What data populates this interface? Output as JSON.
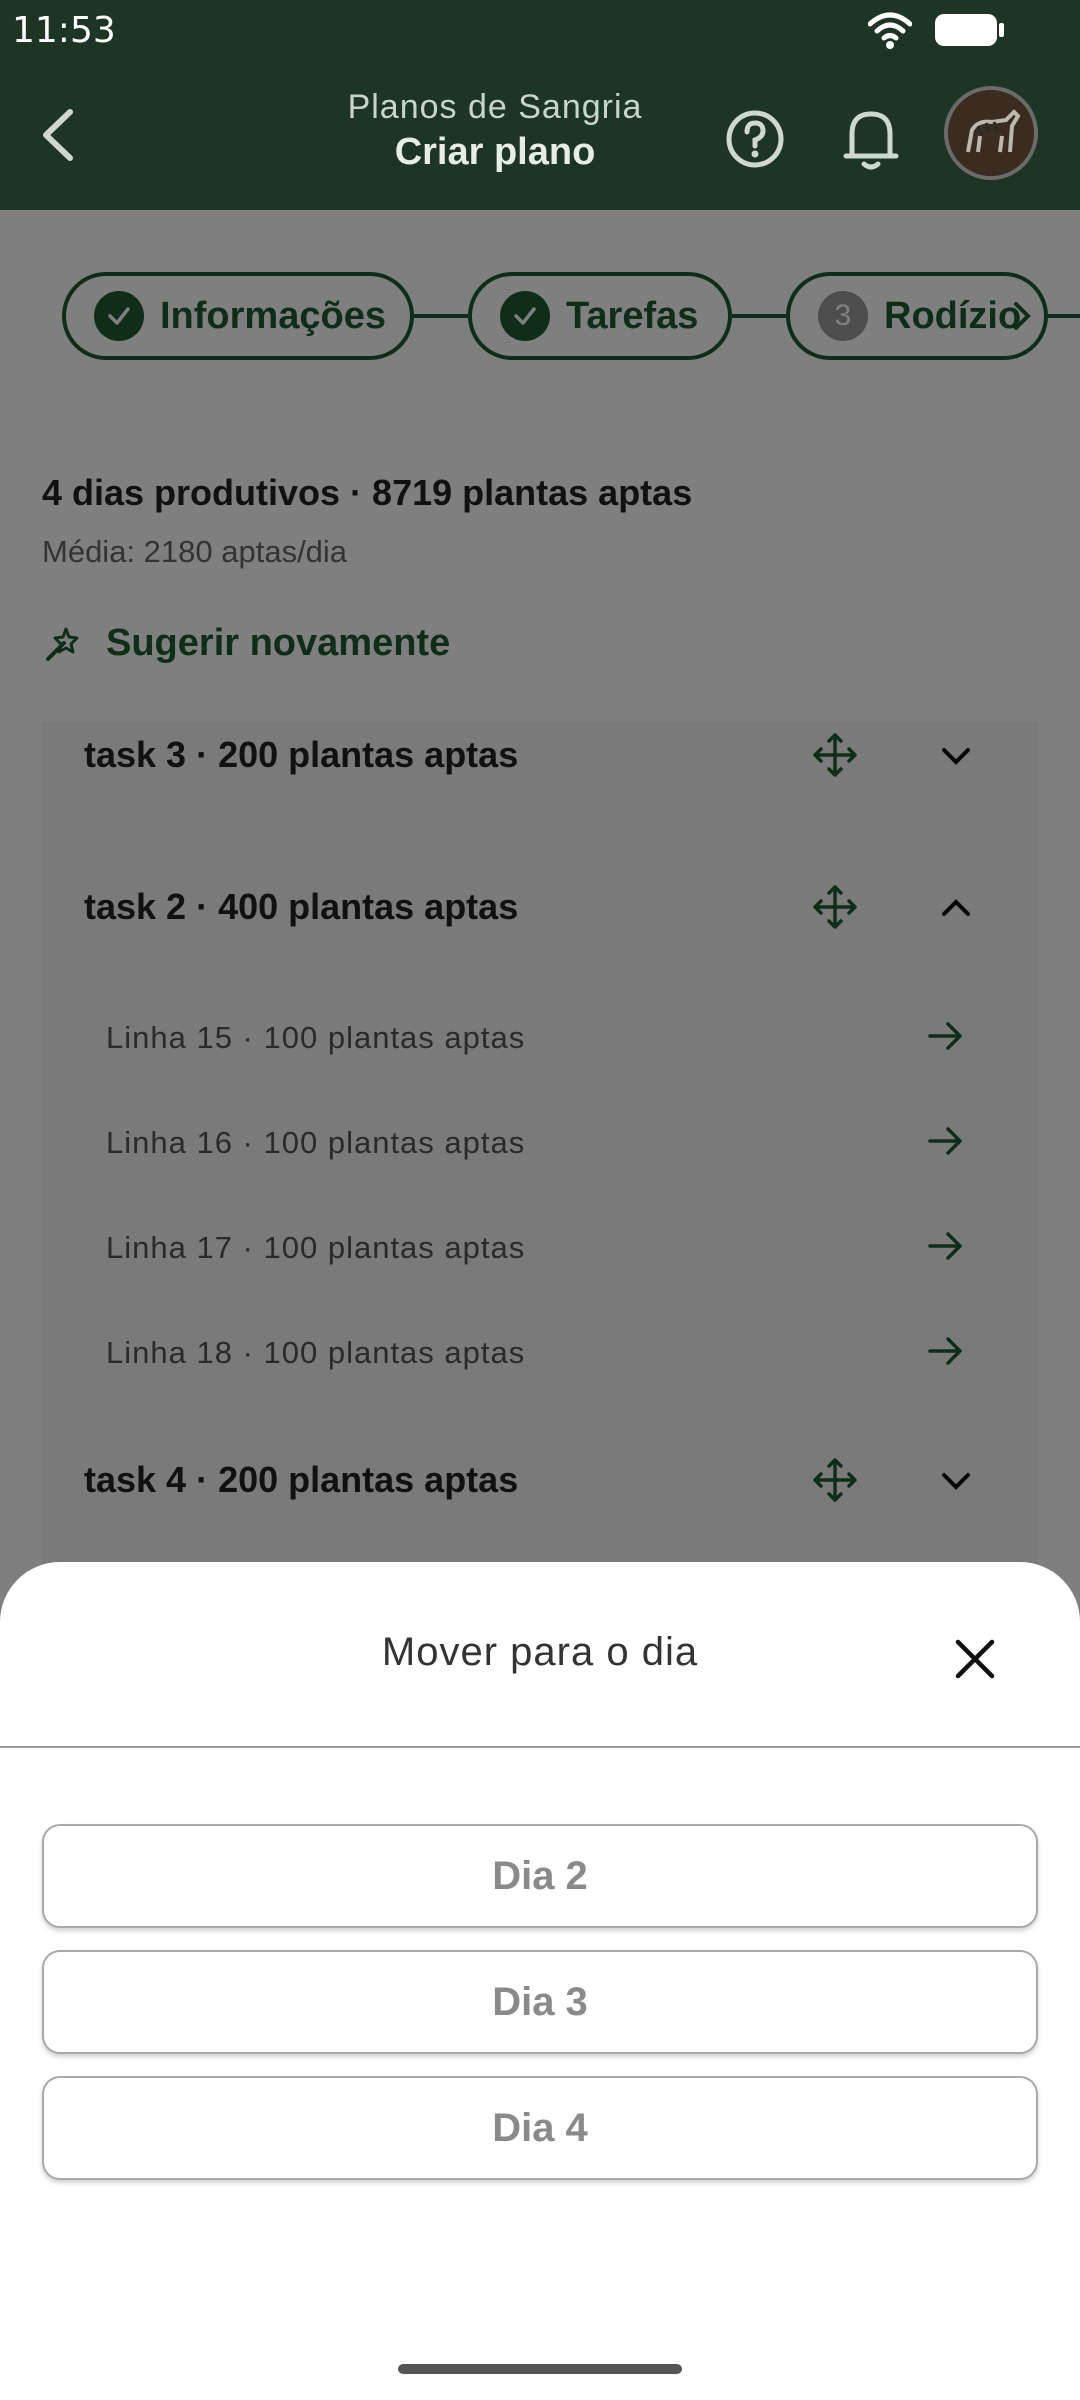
{
  "status_bar": {
    "time": "11:53"
  },
  "app_bar": {
    "subtitle": "Planos de Sangria",
    "title": "Criar plano"
  },
  "stepper": [
    {
      "label": "Informações",
      "state": "done"
    },
    {
      "label": "Tarefas",
      "state": "done"
    },
    {
      "label": "Rodízio",
      "number": "3",
      "state": "current"
    }
  ],
  "summary": {
    "headline": "4 dias produtivos · 8719 plantas aptas",
    "average": "Média: 2180 aptas/dia"
  },
  "suggest_label": "Sugerir novamente",
  "tasks": [
    {
      "label": "task 3 · 200 plantas aptas",
      "expanded": false
    },
    {
      "label": "task 2 · 400 plantas aptas",
      "expanded": true,
      "lines": [
        "Linha 15 · 100 plantas aptas",
        "Linha 16 · 100 plantas aptas",
        "Linha 17 · 100 plantas aptas",
        "Linha 18 · 100 plantas aptas"
      ]
    },
    {
      "label": "task 4 · 200 plantas aptas",
      "expanded": false
    }
  ],
  "sheet": {
    "title": "Mover para o dia",
    "options": [
      "Dia 2",
      "Dia 3",
      "Dia 4"
    ]
  },
  "colors": {
    "primary": "#1f5a33",
    "app_bar": "#1e3425",
    "scrim": "rgba(0,0,0,0.5)"
  },
  "icons": [
    "back-arrow-icon",
    "help-icon",
    "bell-icon",
    "check-icon",
    "chevron-right-icon",
    "magic-wand-icon",
    "move-icon",
    "chevron-down-icon",
    "chevron-up-icon",
    "arrow-right-icon",
    "close-icon"
  ]
}
